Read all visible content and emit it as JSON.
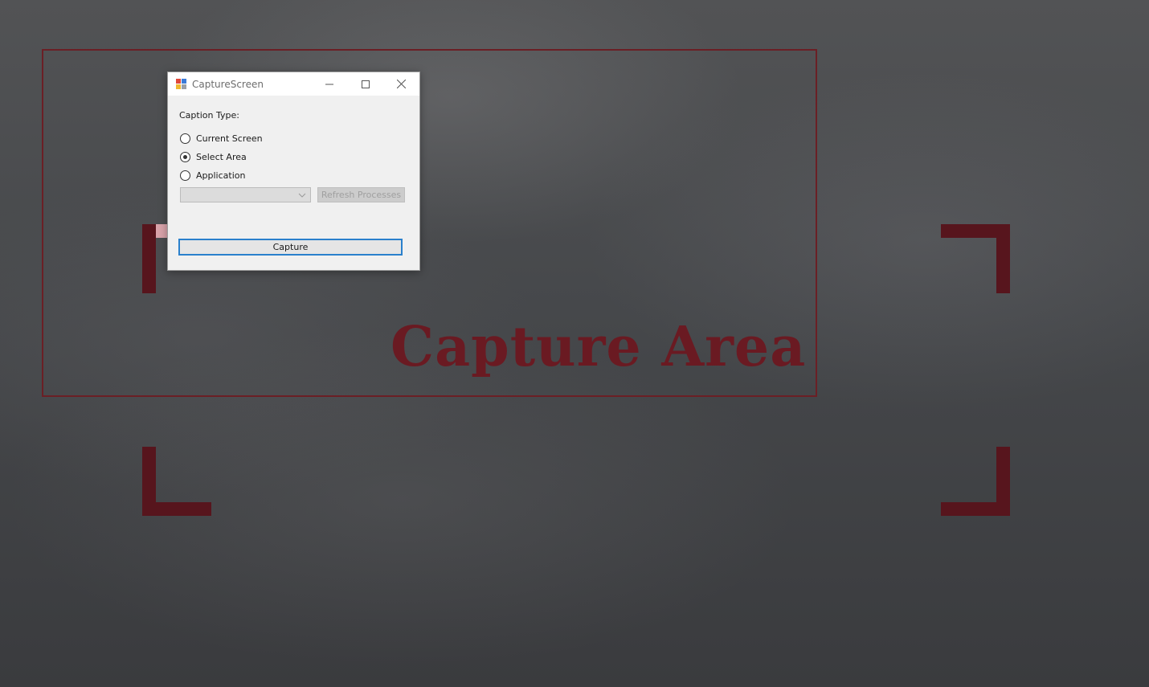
{
  "overlay": {
    "capture_area_text": "Capture Area",
    "accent_color": "#6a1a22"
  },
  "window": {
    "title": "CaptureScreen",
    "icon": "app-icon",
    "controls": [
      "minimize-icon",
      "maximize-icon",
      "close-icon"
    ]
  },
  "form": {
    "caption_type_label": "Caption Type:",
    "options": [
      {
        "label": "Current Screen",
        "checked": false
      },
      {
        "label": "Select Area",
        "checked": true
      },
      {
        "label": "Application",
        "checked": false
      }
    ],
    "process_select_value": "",
    "refresh_label": "Refresh Processes",
    "capture_label": "Capture"
  }
}
